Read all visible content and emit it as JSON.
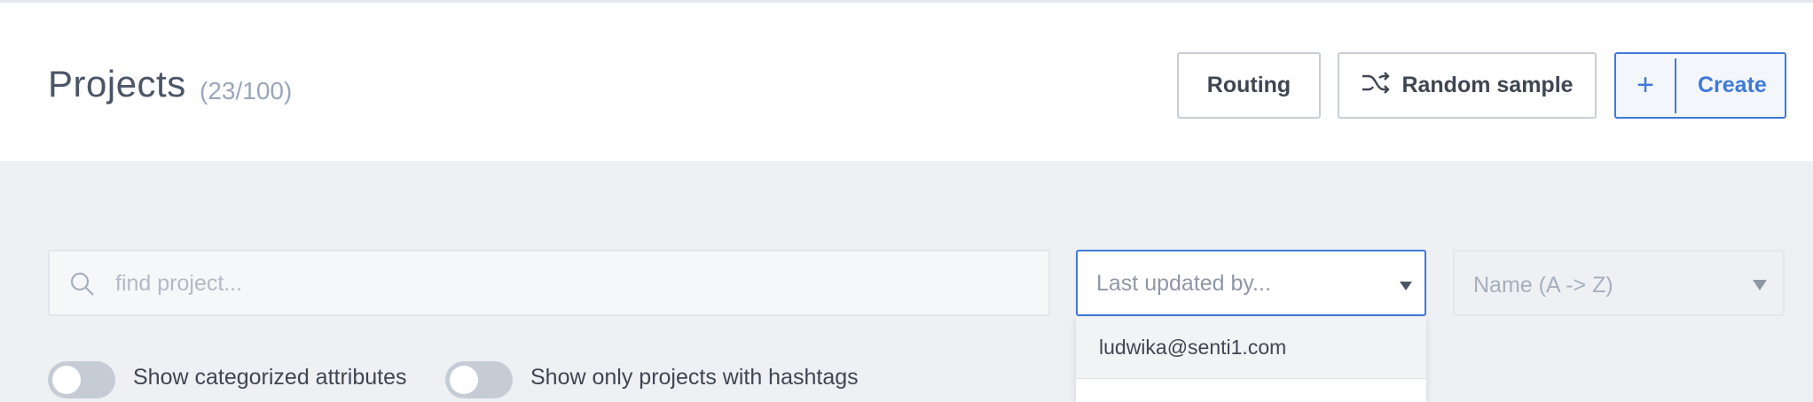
{
  "header": {
    "title": "Projects",
    "count": "(23/100)"
  },
  "buttons": {
    "routing": "Routing",
    "random_sample": "Random sample",
    "create_plus": "+",
    "create": "Create"
  },
  "filters": {
    "search_placeholder": "find project...",
    "updated_by_placeholder": "Last updated by...",
    "sort_value": "Name (A -> Z)",
    "dropdown_options": [
      "ludwika@senti1.com"
    ]
  },
  "toggles": {
    "categorized": {
      "label": "Show categorized attributes",
      "on": false
    },
    "hashtags": {
      "label": "Show only projects with hashtags",
      "on": false
    }
  },
  "colors": {
    "accent": "#3f7ad9",
    "text": "#3f4652",
    "background": "#eef0f4"
  },
  "icons": [
    "shuffle-icon",
    "search-icon",
    "chevron-down-icon"
  ]
}
